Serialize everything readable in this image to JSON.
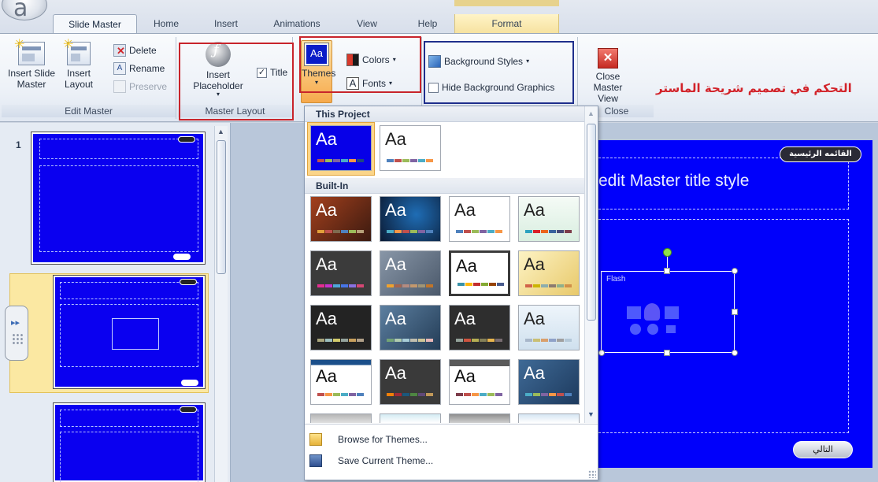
{
  "tabs": [
    {
      "label": "Slide Master",
      "active": true
    },
    {
      "label": "Home"
    },
    {
      "label": "Insert"
    },
    {
      "label": "Animations"
    },
    {
      "label": "View"
    },
    {
      "label": "Help"
    },
    {
      "label": "Format"
    }
  ],
  "ribbon": {
    "edit_master": {
      "label": "Edit Master",
      "insert_slide_master": "Insert Slide Master",
      "insert_layout": "Insert Layout",
      "delete": "Delete",
      "rename": "Rename",
      "preserve": "Preserve"
    },
    "master_layout": {
      "label": "Master Layout",
      "insert_placeholder": "Insert Placeholder",
      "title_checkbox": "Title",
      "title_checked": true
    },
    "edit_theme": {
      "themes": "Themes",
      "colors": "Colors",
      "fonts": "Fonts"
    },
    "background": {
      "background_styles": "Background Styles",
      "hide_background_graphics": "Hide Background Graphics",
      "hide_checked": false
    },
    "close": {
      "label": "Close",
      "close_master_view": "Close Master View"
    }
  },
  "annotation_text": "التحكم في تصميم شريحة الماستر",
  "gallery": {
    "section_project": "This Project",
    "section_builtin": "Built-In",
    "tile_text": "Aa",
    "browse": "Browse for Themes...",
    "save": "Save Current Theme..."
  },
  "thumbnails": {
    "first_number": "1"
  },
  "main_slide": {
    "title": "edit Master title style",
    "home_pill": "القائمه الرئيسية",
    "next_pill": "التالي",
    "placeholder_label": "Flash"
  },
  "colors": {
    "slide_blue": "#0000fb",
    "highlight_red": "#c8242b",
    "highlight_navy": "#1f2f8c"
  }
}
